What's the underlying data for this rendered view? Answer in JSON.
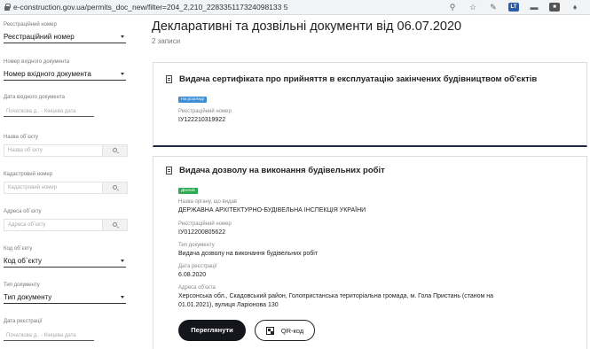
{
  "browser": {
    "url": "e-construction.gov.ua/permits_doc_new/filter=204_2,210_228335117324098133 5"
  },
  "sidebar": {
    "reg_number": {
      "label": "Реєстраційний номер",
      "value": "Реєстраційний номер"
    },
    "incoming_number": {
      "label": "Номер вхідного документа",
      "value": "Номер вхідного документа"
    },
    "incoming_date": {
      "label": "Дата вхідного документа",
      "placeholder": "Початкова д.. - Кінцева дата"
    },
    "object_name": {
      "label": "Назва об`єкту",
      "placeholder": "Назва об`єкту"
    },
    "cadastral": {
      "label": "Кадастровий номер",
      "placeholder": "Кадастровий номер"
    },
    "object_address": {
      "label": "Адреса об`єкту",
      "placeholder": "Адреса об`єкту"
    },
    "object_code": {
      "label": "Код об`єкту",
      "value": "Код об`єкту"
    },
    "doc_type": {
      "label": "Тип документу",
      "value": "Тип документу"
    },
    "reg_date": {
      "label": "Дата реєстрації",
      "placeholder": "Початкова д.. - Кінцева дата"
    }
  },
  "main": {
    "title": "Декларативні та дозвільні документи від 06.07.2020",
    "count": "2 записи"
  },
  "records": [
    {
      "title": "Видача сертифіката про прийняття в експлуатацію закінчених будівництвом об'єктів",
      "status": "На розгляді",
      "status_color": "#3b8fd6",
      "reg_label": "Реєстраційний номер",
      "reg_value": "IУ122210319922"
    },
    {
      "title": "Видача дозволу на виконання будівельних робіт",
      "status": "Діючий",
      "status_color": "#2eaa55",
      "authority_label": "Назва органу, що видав",
      "authority_value": "ДЕРЖАВНА АРХІТЕКТУРНО-БУДІВЕЛЬНА ІНСПЕКЦІЯ УКРАЇНИ",
      "reg_label": "Реєстраційний номер",
      "reg_value": "IУ012200805622",
      "type_label": "Тип документу",
      "type_value": "Видача дозволу на виконання будівельних робіт",
      "date_label": "Дата реєстрації",
      "date_value": "6.08.2020",
      "address_label": "Адреса об'єкта",
      "address_line1": "Херсонська обл., Скадовський район, Голопристанська територіальна громада, м. Гола Пристань (станом на",
      "address_line2": "01.01.2021), вулиця Ларіонова 130",
      "view_button": "Переглянути",
      "qr_button": "QR-код"
    }
  ]
}
